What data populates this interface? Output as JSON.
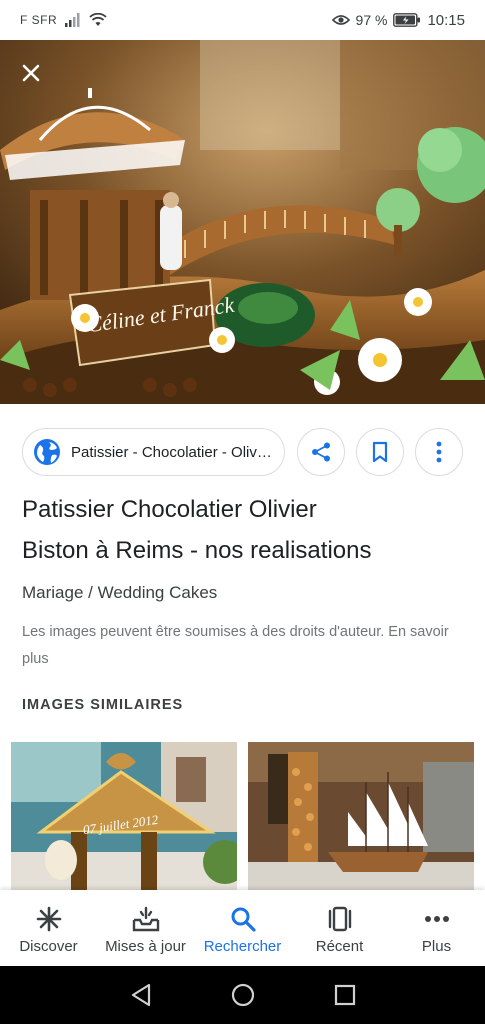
{
  "status_bar": {
    "carrier": "F SFR",
    "battery_percent": "97 %",
    "time": "10:15",
    "icons": [
      "signal-icon",
      "wifi-icon",
      "eye-icon",
      "battery-icon"
    ]
  },
  "viewer": {
    "close_icon": "close-icon",
    "image_caption_text": "Céline et Franck"
  },
  "actions": {
    "source_label": "Patissier - Chocolatier - Olivier Biston à Reims",
    "source_icon": "globe-icon",
    "share_icon": "share-icon",
    "save_icon": "bookmark-icon",
    "more_icon": "more-vert-icon"
  },
  "result": {
    "title_line1": "Patissier Chocolatier Olivier",
    "title_line2": "Biston à Reims - nos realisations",
    "subtitle": "Mariage / Wedding Cakes",
    "rights_notice": "Les images peuvent être soumises à des droits d'auteur. En savoir plus"
  },
  "similar": {
    "heading": "IMAGES SIMILAIRES",
    "thumb1_caption": "07 juillet 2012",
    "thumb2_caption": ""
  },
  "bottom_nav": {
    "items": [
      {
        "label": "Discover",
        "icon": "asterisk-icon",
        "active": false
      },
      {
        "label": "Mises à jour",
        "icon": "updates-tray-icon",
        "active": false
      },
      {
        "label": "Rechercher",
        "icon": "search-icon",
        "active": true
      },
      {
        "label": "Récent",
        "icon": "recent-cards-icon",
        "active": false
      },
      {
        "label": "Plus",
        "icon": "more-horiz-icon",
        "active": false
      }
    ]
  },
  "system_nav": {
    "icons": [
      "back-icon",
      "home-icon",
      "overview-icon"
    ]
  },
  "colors": {
    "accent": "#1a73e8",
    "text_primary": "#202124",
    "text_secondary": "#70757a",
    "border": "#dadce0"
  }
}
